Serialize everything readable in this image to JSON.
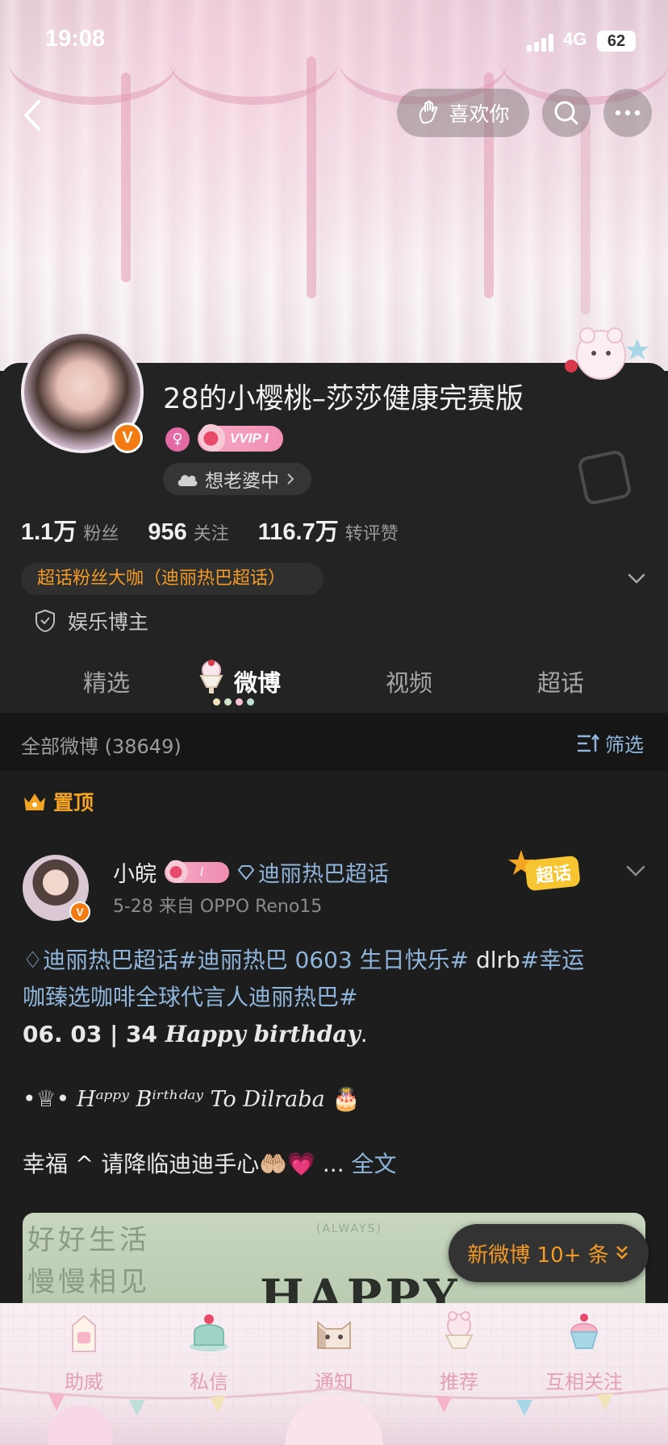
{
  "status_bar": {
    "time": "19:08",
    "network": "4G",
    "battery": "62"
  },
  "header": {
    "like_button_label": "喜欢你"
  },
  "profile": {
    "username": "28的小樱桃–莎莎健康完赛版",
    "vip_badge": "VVIP I",
    "verified_mark": "V",
    "mood_status": "想老婆中",
    "stats": [
      {
        "value": "1.1万",
        "label": "粉丝"
      },
      {
        "value": "956",
        "label": "关注"
      },
      {
        "value": "116.7万",
        "label": "转评赞"
      }
    ],
    "honor_badge": "超话粉丝大咖（迪丽热巴超话）",
    "category": "娱乐博主"
  },
  "tabs": [
    {
      "label": "精选",
      "active": false
    },
    {
      "label": "微博",
      "active": true
    },
    {
      "label": "视频",
      "active": false
    },
    {
      "label": "超话",
      "active": false
    }
  ],
  "feed": {
    "all_posts_label": "全部微博 (38649)",
    "filter_label": "筛选",
    "pinned_label": "置顶",
    "post": {
      "author": "小皖",
      "author_badge": "I",
      "supertopic": "迪丽热巴超话",
      "sticker_label": "超话",
      "meta": "5-28  来自 OPPO Reno15",
      "body": {
        "line1_link": "迪丽热巴超话#迪丽热巴 0603 生日快乐#",
        "line1_plain": " dlrb",
        "line1_link2": "#幸运",
        "line2_link": "咖臻选咖啡全球代言人迪丽热巴#",
        "line3_bold": "06. 03 | 34 ",
        "line3_serif": "Happy birthday",
        "line3_end": ".",
        "line4_prefix": "•♕•",
        "line4_fancy": "Hᵃᵖᵖʸ Bⁱʳᵗʰᵈᵃʸ To Dilraba",
        "line4_emoji": "🎂",
        "line5_text": "幸福 ^ 请降临迪迪手心",
        "line5_emoji": "🤲🏼💗",
        "line5_ellipsis": " ... ",
        "line5_more": "全文"
      },
      "image_texts": {
        "line1": "好好生活",
        "line2": "慢慢相见",
        "tag": "(ALWAYS)",
        "headline": "HAPPY"
      }
    },
    "new_posts_button": "新微博 10+ 条"
  },
  "bottom_tabs": [
    {
      "label": "助威",
      "icon": "milk-carton-icon"
    },
    {
      "label": "私信",
      "icon": "cake-icon"
    },
    {
      "label": "通知",
      "icon": "cat-icon"
    },
    {
      "label": "推荐",
      "icon": "sundae-icon"
    },
    {
      "label": "互相关注",
      "icon": "cupcake-icon"
    }
  ],
  "colors": {
    "accent_orange": "#f39a26",
    "link_blue": "#8fb5db",
    "verified_orange": "#f47b12",
    "tab_pink": "#e4a0b3",
    "background": "#1d1d1d"
  }
}
